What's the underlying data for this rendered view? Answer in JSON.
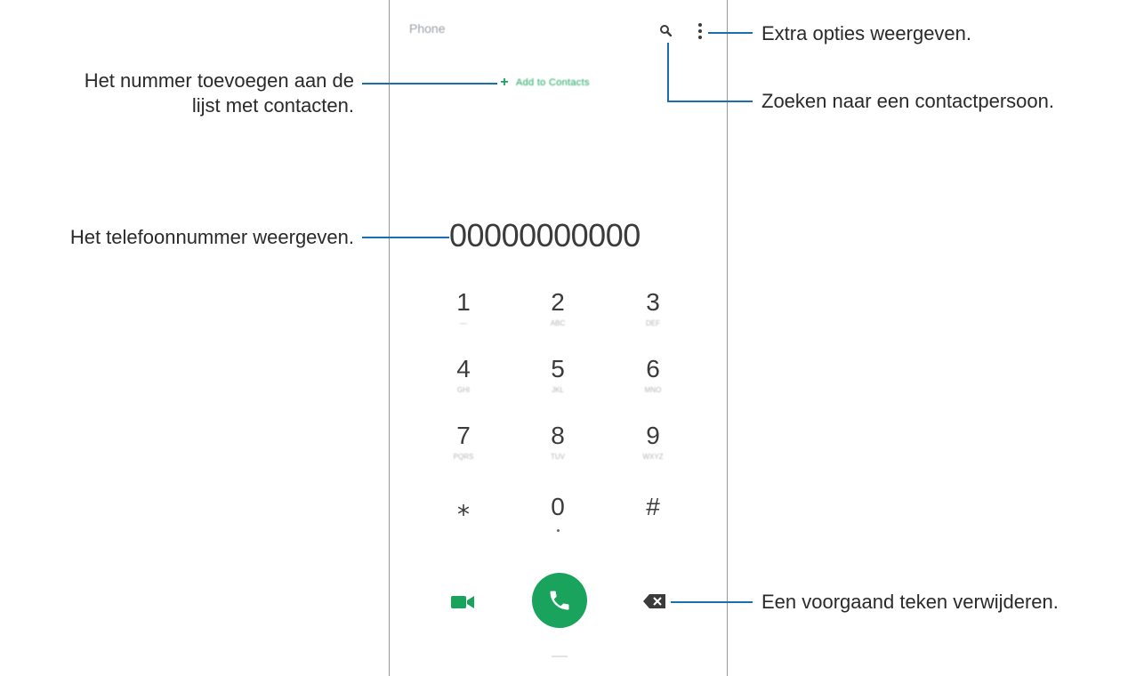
{
  "app": {
    "title": "Phone"
  },
  "header": {
    "search_icon": "search-icon",
    "more_icon": "more-vertical-icon"
  },
  "add_contact": {
    "icon": "plus-icon",
    "label": "Add to Contacts"
  },
  "dial": {
    "number": "00000000000"
  },
  "keypad": [
    {
      "digit": "1",
      "letters": "—"
    },
    {
      "digit": "2",
      "letters": "ABC"
    },
    {
      "digit": "3",
      "letters": "DEF"
    },
    {
      "digit": "4",
      "letters": "GHI"
    },
    {
      "digit": "5",
      "letters": "JKL"
    },
    {
      "digit": "6",
      "letters": "MNO"
    },
    {
      "digit": "7",
      "letters": "PQRS"
    },
    {
      "digit": "8",
      "letters": "TUV"
    },
    {
      "digit": "9",
      "letters": "WXYZ"
    },
    {
      "digit": "⁎",
      "letters": ""
    },
    {
      "digit": "0",
      "letters": "+"
    },
    {
      "digit": "#",
      "letters": ""
    }
  ],
  "actions": {
    "video_icon": "video-call-icon",
    "call_icon": "phone-icon",
    "backspace_icon": "backspace-icon"
  },
  "callouts": {
    "extra_options": "Extra opties weergeven.",
    "search_contact": "Zoeken naar een contactpersoon.",
    "add_to_contacts_line1": "Het nummer toevoegen aan de",
    "add_to_contacts_line2": "lijst met contacten.",
    "show_number": "Het telefoonnummer weergeven.",
    "delete_char": "Een voorgaand teken verwijderen."
  },
  "colors": {
    "accent_green": "#1aa35c",
    "callout_line": "#1a6fb0",
    "text_dark": "#3b3b3b"
  }
}
